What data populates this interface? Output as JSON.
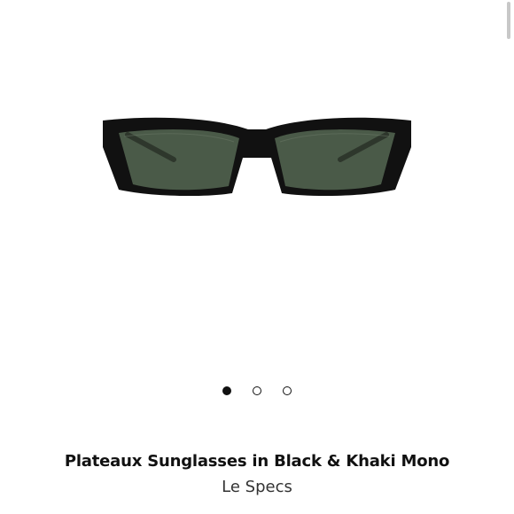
{
  "product": {
    "title": "Plateaux Sunglasses in Black & Khaki Mono",
    "brand": "Le Specs",
    "image_icon": "sunglasses-product-photo",
    "colors": {
      "frame": "#111111",
      "lens": "#4a5a48",
      "background": "#ffffff"
    }
  },
  "carousel": {
    "dot_count": 3,
    "active_index": 0
  }
}
